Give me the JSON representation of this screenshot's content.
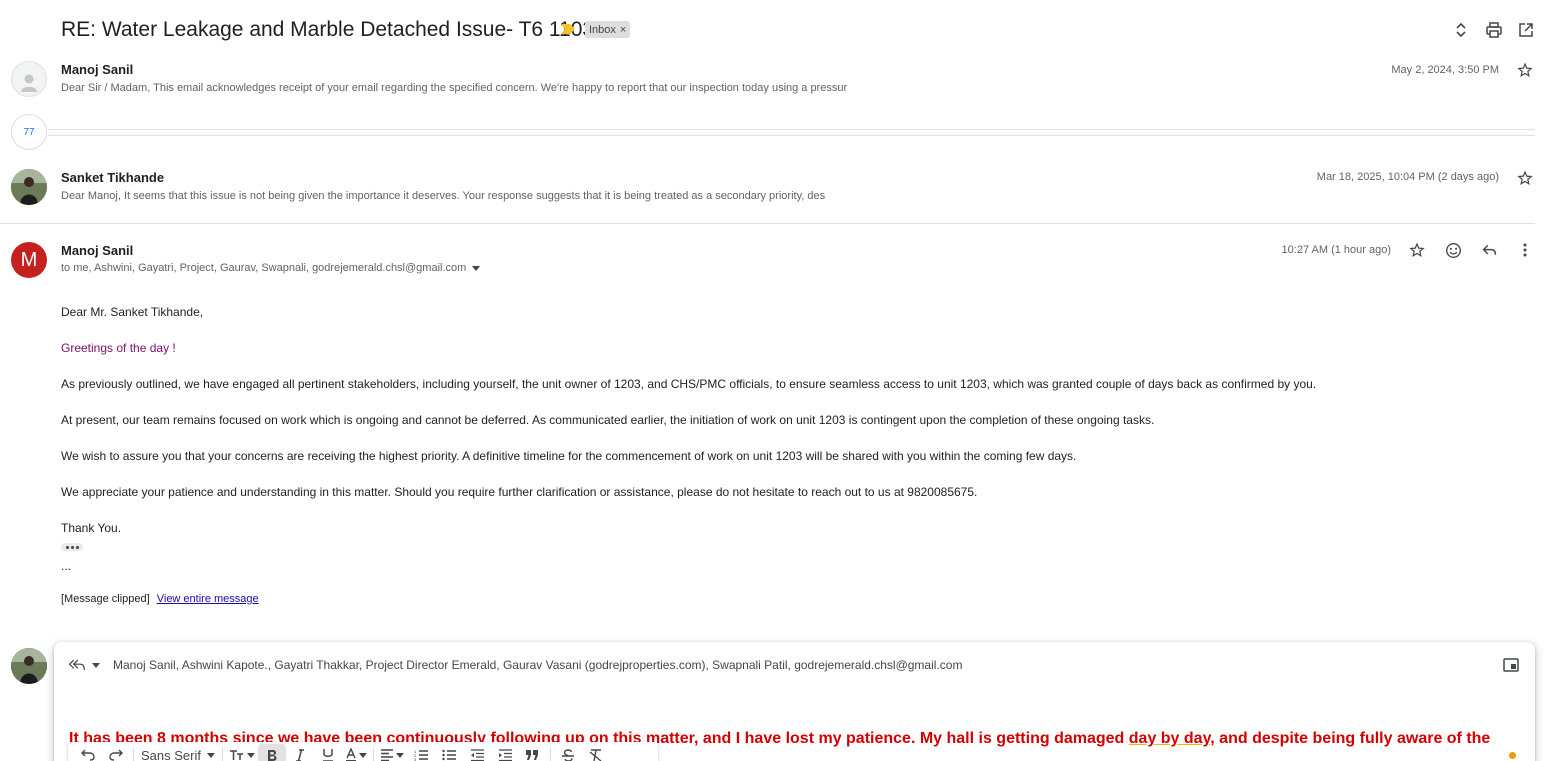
{
  "subject": "RE: Water Leakage and Marble Detached Issue- T6 1103",
  "label_badge": "Inbox",
  "label_remove": "×",
  "colors": {
    "importance": "#f6c026",
    "avatar_m": "#c5221f",
    "greeting": "#7b0f6a",
    "reply_text": "#d30000",
    "link": "#1a0dab"
  },
  "thread": {
    "message1": {
      "sender": "Manoj Sanil",
      "date": "May 2, 2024, 3:50 PM",
      "snippet": "Dear Sir / Madam, This email acknowledges receipt of your email regarding the specified concern. We're happy to report that our inspection today using a pressur"
    },
    "collapsed_count": "77",
    "message2": {
      "sender": "Sanket Tikhande",
      "date": "Mar 18, 2025, 10:04 PM (2 days ago)",
      "snippet": "Dear Manoj, It seems that this issue is not being given the importance it deserves. Your response suggests that it is being treated as a secondary priority, des"
    },
    "message3": {
      "avatar_letter": "M",
      "sender": "Manoj Sanil",
      "date": "10:27 AM (1 hour ago)",
      "recipients": "to me, Ashwini, Gayatri, Project, Gaurav, Swapnali, godrejemerald.chsl@gmail.com",
      "body": {
        "salutation": "Dear Mr. Sanket Tikhande,",
        "greeting": "Greetings of the day !",
        "p1": "As previously outlined, we have engaged all pertinent stakeholders, including yourself, the unit owner of 1203, and CHS/PMC officials, to ensure seamless access to unit 1203, which was granted couple of days back as confirmed by you.",
        "p2": "At present, our team remains focused on work which is ongoing and cannot be deferred. As communicated earlier, the initiation of work on unit 1203 is contingent upon the completion of these ongoing tasks.",
        "p3": "We wish to assure you that your concerns are receiving the highest priority. A definitive timeline for the commencement of work on unit 1203 will be shared with you within the coming few days.",
        "p4": "We appreciate your patience and understanding in this matter. Should you require further clarification or assistance, please do not hesitate to reach out to us at 9820085675.",
        "signoff": "Thank You.",
        "trail": "...",
        "clipped": "[Message clipped]",
        "view_entire": "View entire message"
      }
    }
  },
  "reply": {
    "recipients": "Manoj Sanil, Ashwini Kapote., Gayatri Thakkar, Project Director Emerald, Gaurav Vasani (godrejproperties.com), Swapnali Patil, godrejemerald.chsl@gmail.com",
    "text_part1": "It has been 8 months since we have been continuously following up on this matter, and I have lost my patience. My hall is getting damaged ",
    "text_underlined": "day by day",
    "text_part2": ", and despite being fully aware of the",
    "font": "Sans Serif"
  }
}
